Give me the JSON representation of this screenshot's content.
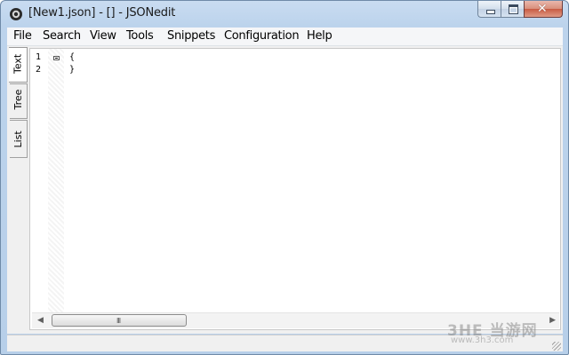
{
  "window": {
    "title": "[New1.json] - [] - JSONedit"
  },
  "menu": [
    "File",
    "Search",
    "View",
    "Tools",
    "Snippets",
    "Configuration",
    "Help"
  ],
  "side_tabs": [
    "Text",
    "Tree",
    "List"
  ],
  "editor": {
    "line_numbers": [
      "1",
      "2"
    ],
    "lines": [
      "{",
      "}"
    ]
  },
  "scrollbar": {
    "grip": "III"
  },
  "watermark": {
    "text": "3HE 当游网",
    "sub": "www.3h3.com"
  },
  "colors": {
    "titlebar": "#bcd3ec",
    "close_button": "#c85b43",
    "menubar": "#f5f6f8"
  }
}
